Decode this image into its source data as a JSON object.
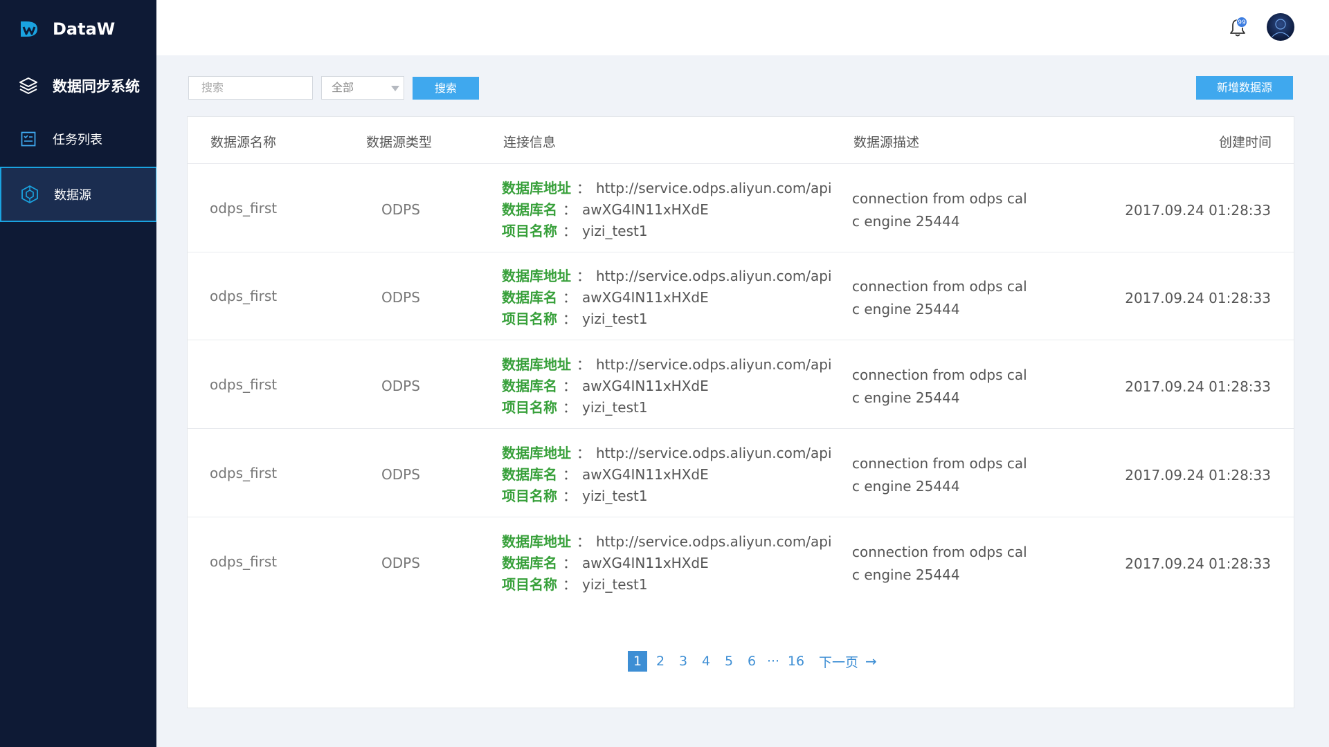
{
  "app": {
    "name": "DataW"
  },
  "sidebar": {
    "items": [
      {
        "label": "数据同步系统",
        "icon": "layers-icon"
      },
      {
        "label": "任务列表",
        "icon": "task-list-icon"
      },
      {
        "label": "数据源",
        "icon": "datasource-icon",
        "active": true
      }
    ]
  },
  "header": {
    "notification_count": "99"
  },
  "toolbar": {
    "search_placeholder": "搜索",
    "filter_selected": "全部",
    "search_button": "搜索",
    "add_button": "新增数据源"
  },
  "table": {
    "columns": [
      "数据源名称",
      "数据源类型",
      "连接信息",
      "数据源描述",
      "创建时间"
    ],
    "rows": [
      {
        "name": "odps_first",
        "type": "ODPS",
        "conn": [
          {
            "key": "数据库地址",
            "sep": "：",
            "value": "http://service.odps.aliyun.com/api"
          },
          {
            "key": "数据库名",
            "sep": "：",
            "value": "awXG4IN11xHXdE"
          },
          {
            "key": "项目名称",
            "sep": "：",
            "value": "yizi_test1"
          }
        ],
        "desc_line1": "connection from odps cal",
        "desc_line2": "c engine 25444",
        "time": "2017.09.24  01:28:33"
      },
      {
        "name": "odps_first",
        "type": "ODPS",
        "conn": [
          {
            "key": "数据库地址",
            "sep": "：",
            "value": "http://service.odps.aliyun.com/api"
          },
          {
            "key": "数据库名",
            "sep": "：",
            "value": "awXG4IN11xHXdE"
          },
          {
            "key": "项目名称",
            "sep": "：",
            "value": "yizi_test1"
          }
        ],
        "desc_line1": "connection from odps cal",
        "desc_line2": "c engine 25444",
        "time": "2017.09.24  01:28:33"
      },
      {
        "name": "odps_first",
        "type": "ODPS",
        "conn": [
          {
            "key": "数据库地址",
            "sep": "：",
            "value": "http://service.odps.aliyun.com/api"
          },
          {
            "key": "数据库名",
            "sep": "：",
            "value": "awXG4IN11xHXdE"
          },
          {
            "key": "项目名称",
            "sep": "：",
            "value": "yizi_test1"
          }
        ],
        "desc_line1": "connection from odps cal",
        "desc_line2": "c engine 25444",
        "time": "2017.09.24  01:28:33"
      },
      {
        "name": "odps_first",
        "type": "ODPS",
        "conn": [
          {
            "key": "数据库地址",
            "sep": "：",
            "value": "http://service.odps.aliyun.com/api"
          },
          {
            "key": "数据库名",
            "sep": "：",
            "value": "awXG4IN11xHXdE"
          },
          {
            "key": "项目名称",
            "sep": "：",
            "value": "yizi_test1"
          }
        ],
        "desc_line1": "connection from odps cal",
        "desc_line2": "c engine 25444",
        "time": "2017.09.24  01:28:33"
      },
      {
        "name": "odps_first",
        "type": "ODPS",
        "conn": [
          {
            "key": "数据库地址",
            "sep": "：",
            "value": "http://service.odps.aliyun.com/api"
          },
          {
            "key": "数据库名",
            "sep": "：",
            "value": "awXG4IN11xHXdE"
          },
          {
            "key": "项目名称",
            "sep": "：",
            "value": "yizi_test1"
          }
        ],
        "desc_line1": "connection from odps cal",
        "desc_line2": "c engine 25444",
        "time": "2017.09.24  01:28:33"
      }
    ]
  },
  "pagination": {
    "pages": [
      "1",
      "2",
      "3",
      "4",
      "5",
      "6"
    ],
    "current": "1",
    "ellipsis": "···",
    "last": "16",
    "next_label": "下一页",
    "next_arrow": "→"
  },
  "colors": {
    "sidebar_bg": "#0e1a35",
    "accent": "#3fa8ee",
    "key_green": "#37a03a",
    "page_blue": "#3d8ed4"
  }
}
